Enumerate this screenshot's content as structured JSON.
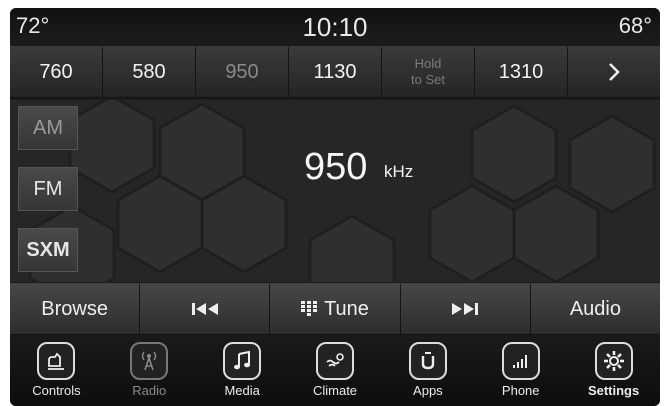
{
  "status": {
    "temp_left": "72°",
    "clock": "10:10",
    "temp_right": "68°"
  },
  "presets": [
    {
      "label": "760",
      "state": "normal"
    },
    {
      "label": "580",
      "state": "normal"
    },
    {
      "label": "950",
      "state": "active"
    },
    {
      "label": "1130",
      "state": "normal"
    },
    {
      "label": "Hold",
      "label2": "to Set",
      "state": "hold"
    },
    {
      "label": "1310",
      "state": "normal"
    }
  ],
  "presets_next_icon": "chevron-right-icon",
  "bands": {
    "am": "AM",
    "fm": "FM",
    "sxm": "SXM"
  },
  "tuner": {
    "frequency": "950",
    "unit": "kHz"
  },
  "controls": {
    "browse": "Browse",
    "seek_back_icon": "⏮",
    "tune": "Tune",
    "tune_icon": "grid-icon",
    "seek_forward_icon": "⏭",
    "audio": "Audio"
  },
  "nav": [
    {
      "label": "Controls",
      "icon": "controls-icon"
    },
    {
      "label": "Radio",
      "icon": "radio-tower-icon"
    },
    {
      "label": "Media",
      "icon": "music-note-icon"
    },
    {
      "label": "Climate",
      "icon": "climate-icon"
    },
    {
      "label": "Apps",
      "icon": "apps-icon"
    },
    {
      "label": "Phone",
      "icon": "phone-signal-icon"
    },
    {
      "label": "Settings",
      "icon": "gear-icon"
    }
  ],
  "colors": {
    "background": "#1b1b1b",
    "button": "#3a3a3a",
    "text": "#eeeeee",
    "dim_text": "#8a8a8a"
  }
}
